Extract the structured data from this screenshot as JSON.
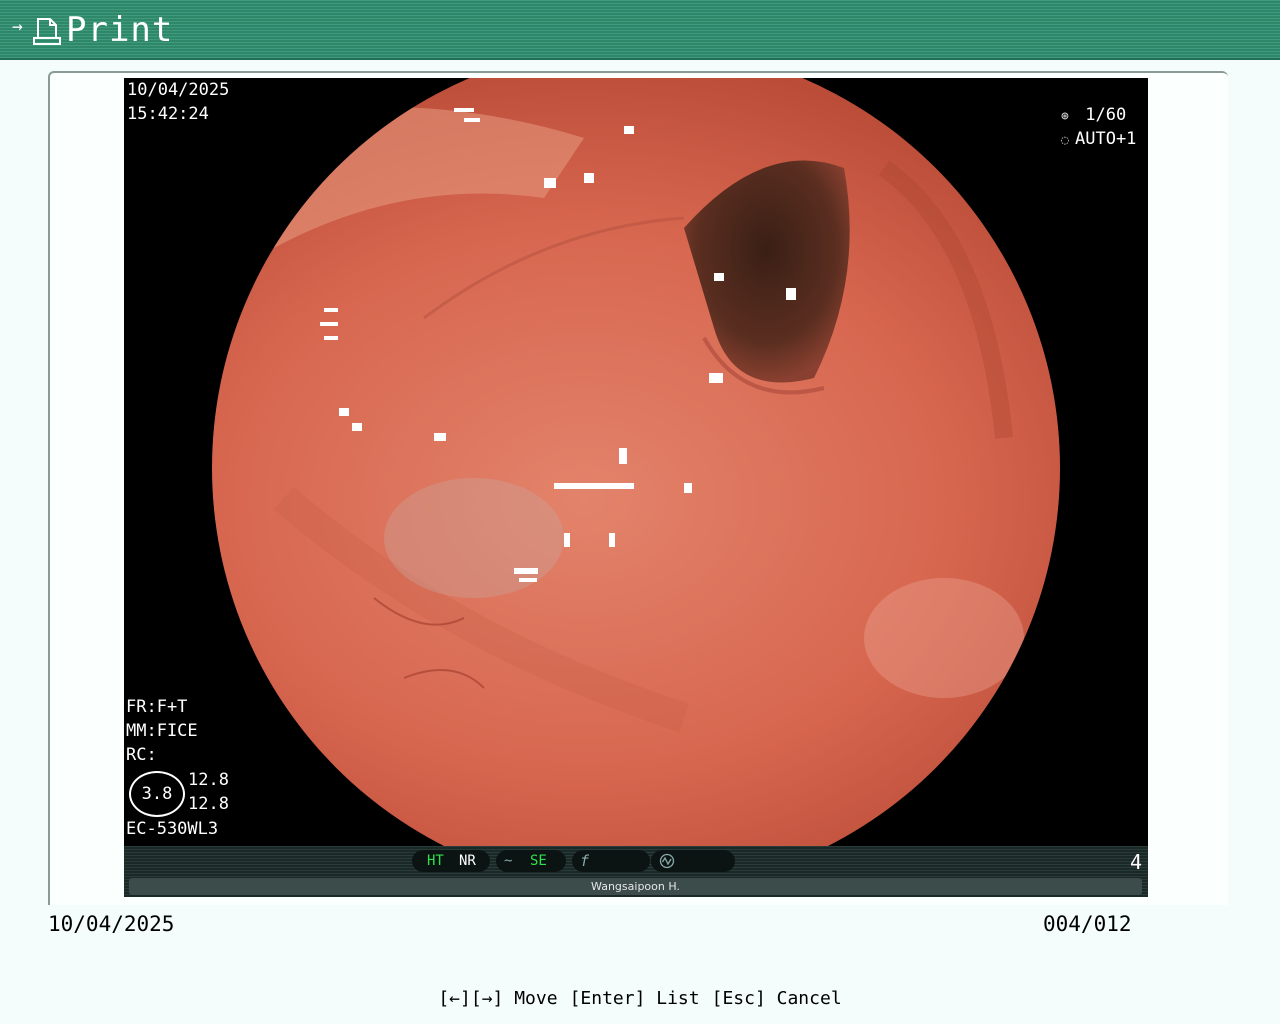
{
  "titlebar": {
    "arrow": "→",
    "title": "Print"
  },
  "image": {
    "date": "10/04/2025",
    "time": "15:42:24",
    "shutter": "1/60",
    "auto": "AUTO+1",
    "fr": "FR:F+T",
    "mm": "MM:FICE",
    "rc": "RC:",
    "circle_value": "3.8",
    "value_top": "12.8",
    "value_bottom": "12.8",
    "scope_model": "EC-530WL3"
  },
  "strip": {
    "ht": "HT",
    "nr": "NR",
    "se": "SE",
    "page_number": "4",
    "operator": "Wangsaipoon H."
  },
  "footer": {
    "date": "10/04/2025",
    "counter": "004/012"
  },
  "help": {
    "move": "[←][→] Move",
    "list": "[Enter] List",
    "cancel": "[Esc] Cancel"
  },
  "colors": {
    "titlebar": "#2f8769",
    "background": "#f4fdfb",
    "tissue": "#d9705a",
    "indicator_green": "#2ee04a"
  }
}
